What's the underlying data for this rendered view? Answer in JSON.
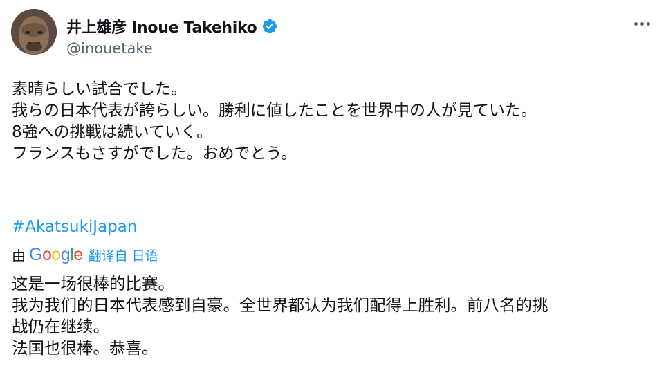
{
  "author": {
    "display_name": "井上雄彦 Inoue Takehiko",
    "handle": "@inouetake",
    "verified_icon": "verified-badge-icon",
    "avatar_icon": "user-avatar"
  },
  "more_icon": "more-options-icon",
  "tweet": {
    "lines": [
      "素晴らしい試合でした。",
      "我らの日本代表が誇らしい。勝利に値したことを世界中の人が見ていた。",
      "8強への挑戦は続いていく。",
      "フランスもさすがでした。おめでとう。"
    ],
    "hashtag": "#AkatsukiJapan"
  },
  "translation_bar": {
    "by": "由",
    "provider_letters": [
      "G",
      "o",
      "o",
      "g",
      "l",
      "e"
    ],
    "link": "翻译自 日语"
  },
  "translation": {
    "lines": [
      "这是一场很棒的比赛。",
      "我为我们的日本代表感到自豪。全世界都认为我们配得上胜利。前八名的挑",
      "战仍在继续。",
      "法国也很棒。恭喜。"
    ]
  },
  "colors": {
    "link": "#1d9bf0",
    "muted": "#536471",
    "text": "#0f1419",
    "verified": "#1d9bf0"
  }
}
